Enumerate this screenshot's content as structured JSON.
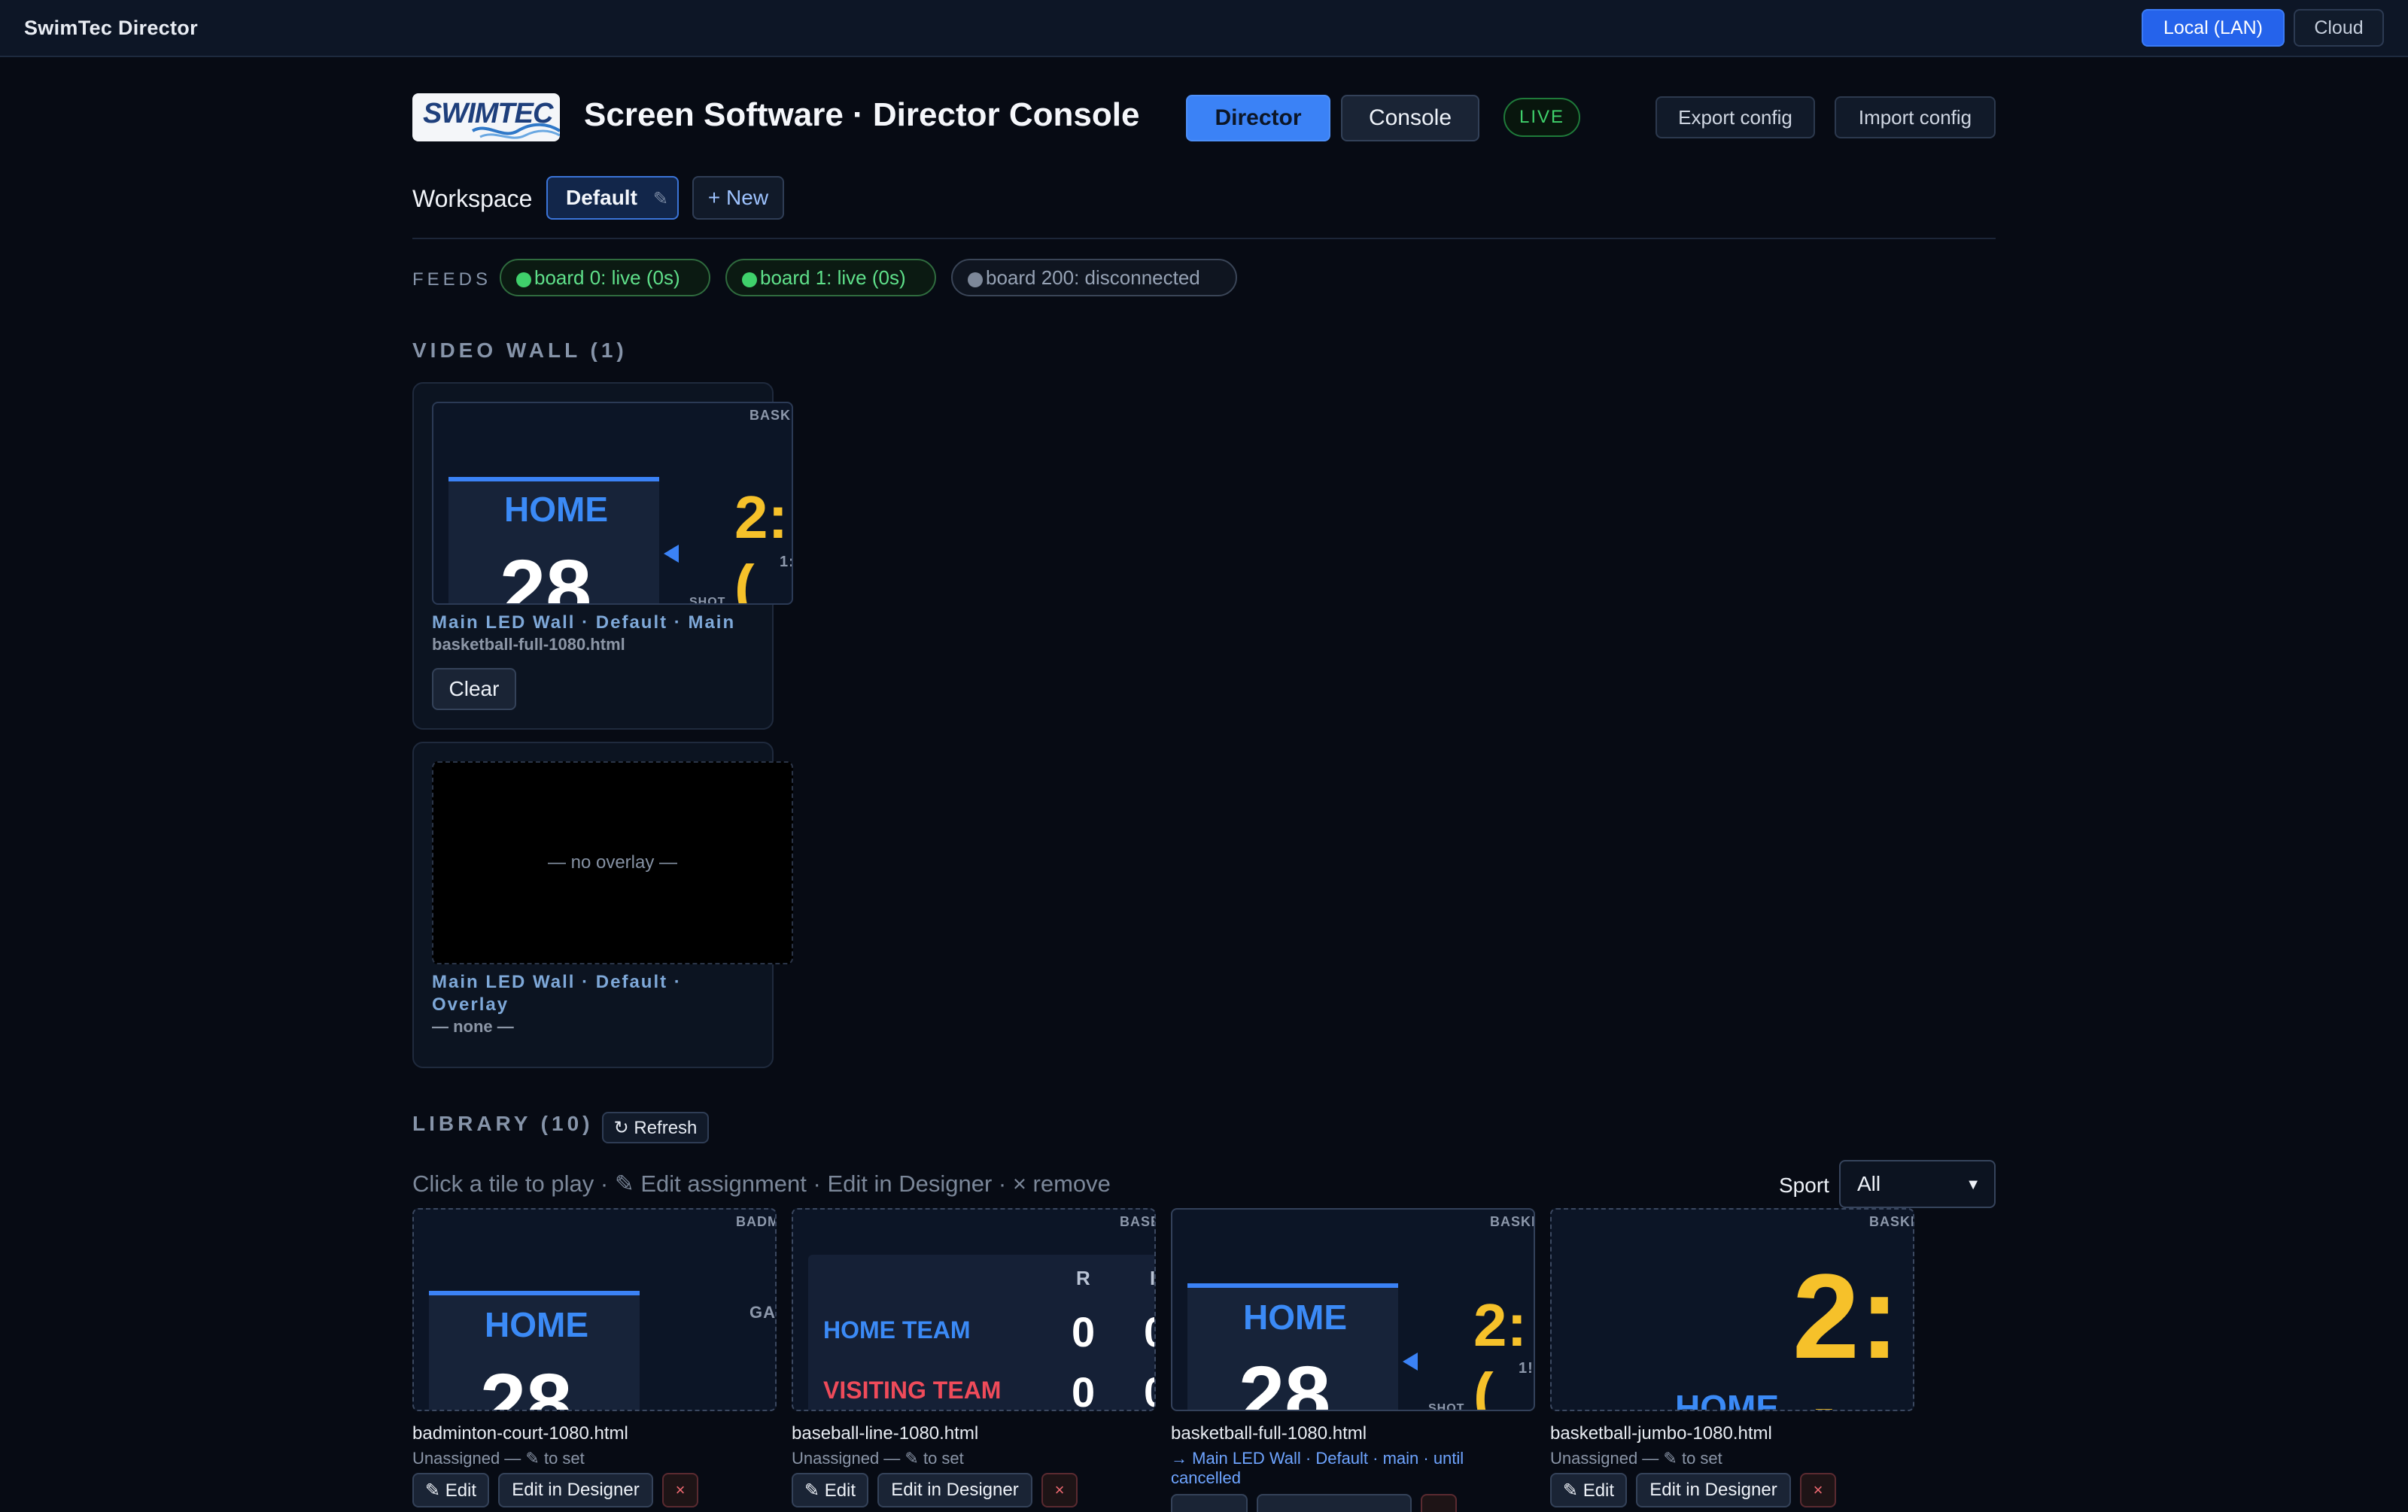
{
  "app": {
    "title": "SwimTec Director"
  },
  "connection": {
    "local_label": "Local (LAN)",
    "cloud_label": "Cloud"
  },
  "header": {
    "logo_text": "SWIMTEC",
    "title": "Screen Software · Director Console",
    "tabs": [
      {
        "label": "Director"
      },
      {
        "label": "Console"
      }
    ],
    "live_badge": "LIVE",
    "export_label": "Export config",
    "import_label": "Import config"
  },
  "workspace": {
    "label": "Workspace",
    "current": "Default",
    "new_label": "+ New"
  },
  "feeds": {
    "label": "FEEDS",
    "items": [
      {
        "text": "board 0: live (0s)"
      },
      {
        "text": "board 1: live (0s)"
      },
      {
        "text": "board 200: disconnected"
      }
    ]
  },
  "video_wall": {
    "title": "VIDEO WALL (1)",
    "main": {
      "meta": "Main LED Wall · Default · Main",
      "file": "basketball-full-1080.html",
      "clear_label": "Clear",
      "preview": {
        "tag": "BASKE",
        "home": "HOME",
        "score": "28",
        "clock": "2:(",
        "sub": "1:",
        "shot": "SHOT"
      }
    },
    "overlay": {
      "meta_line1": "Main LED Wall · Default ·",
      "meta_line2": "Overlay",
      "file": "— none —",
      "empty_text": "— no overlay —"
    }
  },
  "library": {
    "title": "LIBRARY (10)",
    "refresh_label": "↻ Refresh",
    "hint": "Click a tile to play · ✎ Edit assignment · Edit in Designer · × remove",
    "sport_label": "Sport",
    "sport_value": "All",
    "edit_label": "✎ Edit",
    "designer_label": "Edit in Designer",
    "remove_label": "×",
    "tiles": [
      {
        "name": "badminton-court-1080.html",
        "status": "Unassigned — ✎ to set",
        "tag": "BADM",
        "home": "HOME",
        "score": "28",
        "side": "GA"
      },
      {
        "name": "baseball-line-1080.html",
        "status": "Unassigned — ✎ to set",
        "tag": "BASE",
        "col": "R",
        "col2": "I",
        "home": "HOME TEAM",
        "visit": "VISITING TEAM",
        "home_runs": "0",
        "visit_runs": "0",
        "home_runs2": "0",
        "visit_runs2": "0"
      },
      {
        "name": "basketball-full-1080.html",
        "status_line1": "→ Main LED Wall · Default · main · until",
        "status_line2": "cancelled",
        "tag": "BASKE",
        "home": "HOME",
        "score": "28",
        "clock": "2:(",
        "sub": "1!",
        "shot": "SHOT"
      },
      {
        "name": "basketball-jumbo-1080.html",
        "status": "Unassigned — ✎ to set",
        "tag": "BASKE",
        "clock": "2:(",
        "home": "HOME"
      }
    ]
  },
  "colors": {
    "accent": "#3b82f6",
    "live": "#3fd06b",
    "clock": "#f6c12a",
    "danger": "#f16a72",
    "visit": "#ef4b5a"
  }
}
